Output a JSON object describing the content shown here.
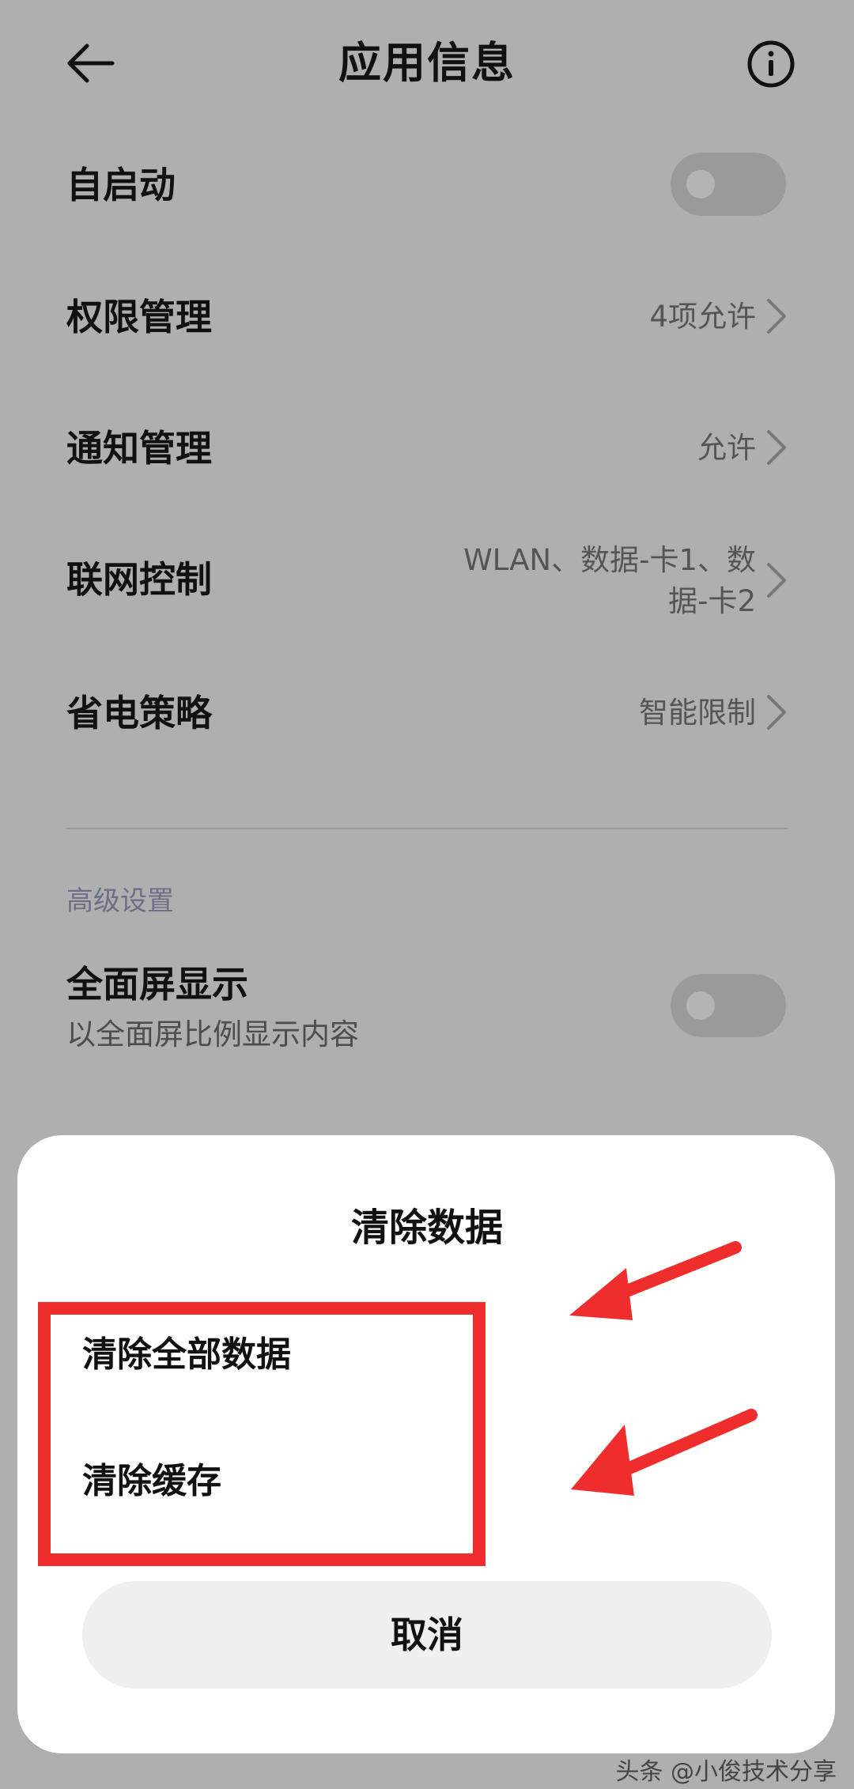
{
  "header": {
    "title": "应用信息",
    "back_icon": "back-arrow-icon",
    "info_icon": "info-icon"
  },
  "settings": {
    "autostart": {
      "label": "自启动",
      "enabled": false
    },
    "permissions": {
      "label": "权限管理",
      "value": "4项允许"
    },
    "notifications": {
      "label": "通知管理",
      "value": "允许"
    },
    "network": {
      "label": "联网控制",
      "value_line1": "WLAN、数据-卡1、数",
      "value_line2": "据-卡2"
    },
    "battery": {
      "label": "省电策略",
      "value": "智能限制"
    }
  },
  "advanced": {
    "section_label": "高级设置",
    "fullscreen": {
      "label": "全面屏显示",
      "subtitle": "以全面屏比例显示内容",
      "enabled": false
    }
  },
  "dialog": {
    "title": "清除数据",
    "options": [
      "清除全部数据",
      "清除缓存"
    ],
    "cancel": "取消"
  },
  "annotations": {
    "highlight_color": "#f02d2d"
  },
  "watermark": "头条 @小俊技术分享"
}
